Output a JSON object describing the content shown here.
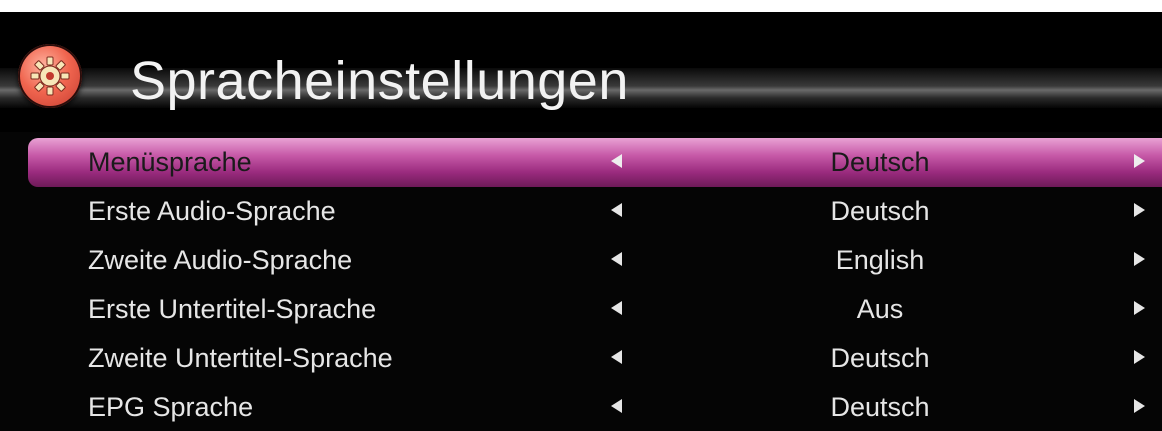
{
  "header": {
    "title": "Spracheinstellungen",
    "icon": "gear-icon"
  },
  "colors": {
    "selection": "#b23d92",
    "icon_badge": "#f0654f",
    "text": "#e6e6e6"
  },
  "menu": {
    "items": [
      {
        "label": "Menüsprache",
        "value": "Deutsch",
        "selected": true
      },
      {
        "label": "Erste Audio-Sprache",
        "value": "Deutsch",
        "selected": false
      },
      {
        "label": "Zweite Audio-Sprache",
        "value": "English",
        "selected": false
      },
      {
        "label": "Erste Untertitel-Sprache",
        "value": "Aus",
        "selected": false
      },
      {
        "label": "Zweite Untertitel-Sprache",
        "value": "Deutsch",
        "selected": false
      },
      {
        "label": "EPG Sprache",
        "value": "Deutsch",
        "selected": false
      }
    ]
  }
}
